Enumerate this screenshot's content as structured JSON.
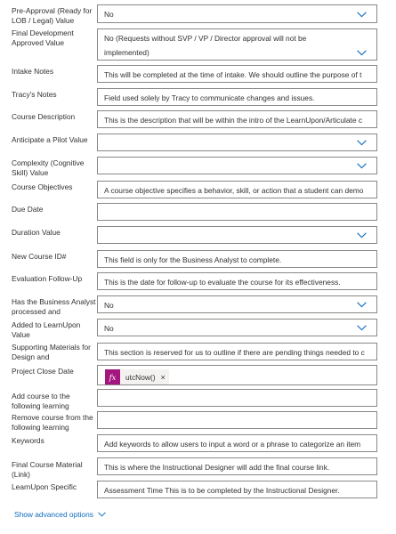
{
  "fields": [
    {
      "label": "Pre-Approval (Ready for LOB / Legal) Value",
      "type": "dropdown",
      "value": "No"
    },
    {
      "label": "Final Development Approved Value",
      "type": "dropdown-multi",
      "value": "No (Requests without SVP / VP / Director approval will not be implemented)"
    },
    {
      "label": "Intake Notes",
      "type": "text",
      "value": "This will be completed at the time of intake. We should outline the purpose of t"
    },
    {
      "label": "Tracy's Notes",
      "type": "text",
      "value": "Field used solely by Tracy to communicate changes and issues."
    },
    {
      "label": "Course Description",
      "type": "text",
      "value": "This is the description that will be within the intro of the LearnUpon/Articulate c"
    },
    {
      "label": "Anticipate a Pilot Value",
      "type": "dropdown",
      "value": ""
    },
    {
      "label": "Complexity (Cognitive Skill) Value",
      "type": "dropdown",
      "value": ""
    },
    {
      "label": "Course Objectives",
      "type": "text",
      "value": "A course objective specifies a behavior, skill, or action that a student can demo"
    },
    {
      "label": "Due Date",
      "type": "text",
      "value": ""
    },
    {
      "label": "Duration Value",
      "type": "dropdown",
      "value": ""
    },
    {
      "label": "New Course ID#",
      "type": "text",
      "value": "This field is only for the Business Analyst to complete."
    },
    {
      "label": "Evaluation Follow-Up",
      "type": "text",
      "value": "This is the date for follow-up to evaluate the course for its effectiveness."
    },
    {
      "label": "Has the Business Analyst processed and",
      "type": "dropdown",
      "value": "No"
    },
    {
      "label": "Added to LearnUpon Value",
      "type": "dropdown",
      "value": "No"
    },
    {
      "label": "Supporting Materials for Design and",
      "type": "text",
      "value": "This section is reserved for us to outline if there are pending things needed to c"
    },
    {
      "label": "Project Close Date",
      "type": "token",
      "value": "utcNow()"
    },
    {
      "label": "Add course to the following learning",
      "type": "text",
      "value": ""
    },
    {
      "label": "Remove course from the following learning",
      "type": "text",
      "value": ""
    },
    {
      "label": "Keywords",
      "type": "text",
      "value": "Add keywords to allow users to input a word or a phrase to categorize an item"
    },
    {
      "label": "Final Course Material (Link)",
      "type": "text",
      "value": "This is where the Instructional Designer will add the final course link."
    },
    {
      "label": "LearnUpon Specific",
      "type": "text",
      "value": "Assessment Time This is to be completed by the Instructional Designer."
    }
  ],
  "token": {
    "icon_text": "fx",
    "close": "×"
  },
  "advanced_link": "Show advanced options",
  "colors": {
    "accent": "#0f6cbd",
    "fx_badge": "#a4167f",
    "border": "#8a8886"
  }
}
